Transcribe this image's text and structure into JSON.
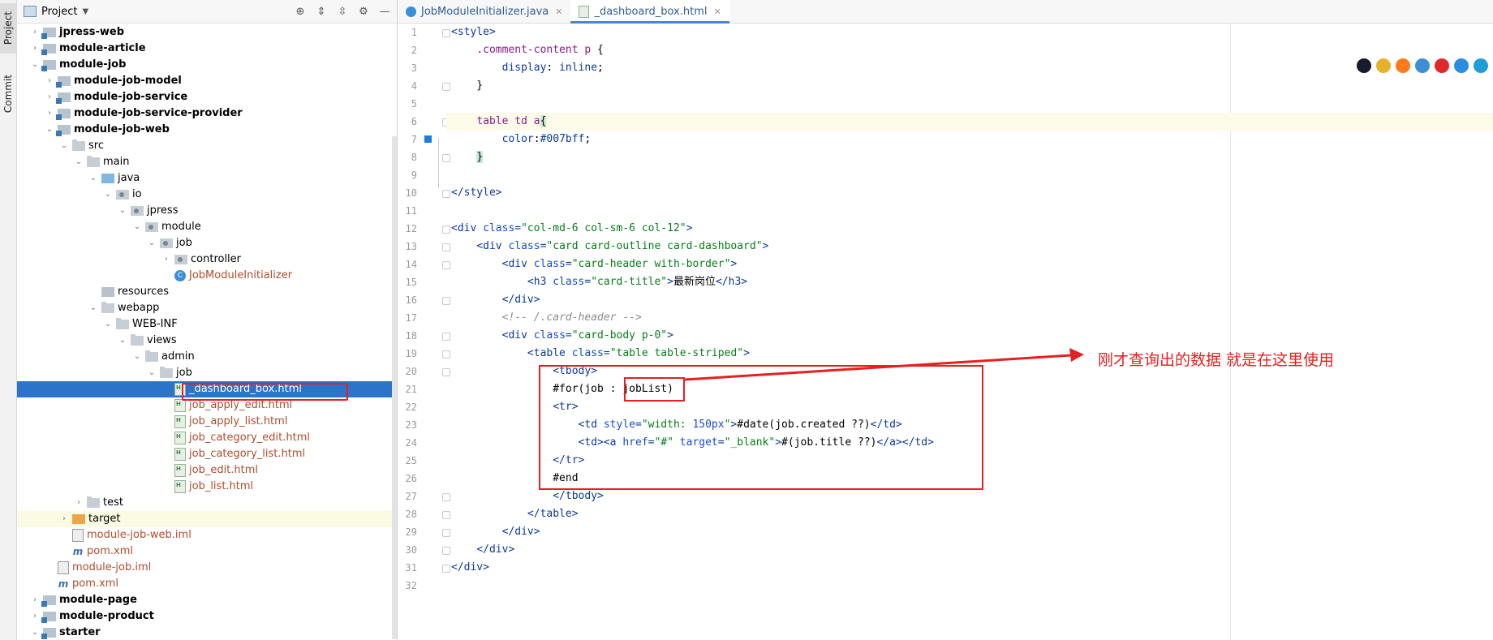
{
  "tool_strip": {
    "project_label": "Project",
    "commit_label": "Commit"
  },
  "project_panel": {
    "title": "Project",
    "tree": [
      {
        "label": "jpress-web",
        "indent": 1,
        "arrow": "closed",
        "icon": "modfolder",
        "style": "bold"
      },
      {
        "label": "module-article",
        "indent": 1,
        "arrow": "closed",
        "icon": "modfolder",
        "style": "bold"
      },
      {
        "label": "module-job",
        "indent": 1,
        "arrow": "open",
        "icon": "modfolder",
        "style": "bold"
      },
      {
        "label": "module-job-model",
        "indent": 2,
        "arrow": "closed",
        "icon": "modfolder",
        "style": "bold"
      },
      {
        "label": "module-job-service",
        "indent": 2,
        "arrow": "closed",
        "icon": "modfolder",
        "style": "bold"
      },
      {
        "label": "module-job-service-provider",
        "indent": 2,
        "arrow": "closed",
        "icon": "modfolder",
        "style": "bold"
      },
      {
        "label": "module-job-web",
        "indent": 2,
        "arrow": "open",
        "icon": "modfolder",
        "style": "bold"
      },
      {
        "label": "src",
        "indent": 3,
        "arrow": "open",
        "icon": "folder",
        "style": ""
      },
      {
        "label": "main",
        "indent": 4,
        "arrow": "open",
        "icon": "folder",
        "style": ""
      },
      {
        "label": "java",
        "indent": 5,
        "arrow": "open",
        "icon": "java",
        "style": ""
      },
      {
        "label": "io",
        "indent": 6,
        "arrow": "open",
        "icon": "pkg",
        "style": ""
      },
      {
        "label": "jpress",
        "indent": 7,
        "arrow": "open",
        "icon": "pkg",
        "style": ""
      },
      {
        "label": "module",
        "indent": 8,
        "arrow": "open",
        "icon": "pkg",
        "style": ""
      },
      {
        "label": "job",
        "indent": 9,
        "arrow": "open",
        "icon": "pkg",
        "style": ""
      },
      {
        "label": "controller",
        "indent": 10,
        "arrow": "closed",
        "icon": "pkg",
        "style": ""
      },
      {
        "label": "JobModuleInitializer",
        "indent": 10,
        "arrow": "",
        "icon": "cls",
        "style": "red"
      },
      {
        "label": "resources",
        "indent": 5,
        "arrow": "",
        "icon": "res",
        "style": ""
      },
      {
        "label": "webapp",
        "indent": 5,
        "arrow": "open",
        "icon": "folder",
        "style": ""
      },
      {
        "label": "WEB-INF",
        "indent": 6,
        "arrow": "open",
        "icon": "folder",
        "style": ""
      },
      {
        "label": "views",
        "indent": 7,
        "arrow": "open",
        "icon": "folder",
        "style": ""
      },
      {
        "label": "admin",
        "indent": 8,
        "arrow": "open",
        "icon": "folder",
        "style": ""
      },
      {
        "label": "job",
        "indent": 9,
        "arrow": "open",
        "icon": "folder",
        "style": ""
      },
      {
        "label": "_dashboard_box.html",
        "indent": 10,
        "arrow": "",
        "icon": "html",
        "style": "selected"
      },
      {
        "label": "job_apply_edit.html",
        "indent": 10,
        "arrow": "",
        "icon": "html",
        "style": "red"
      },
      {
        "label": "job_apply_list.html",
        "indent": 10,
        "arrow": "",
        "icon": "html",
        "style": "red"
      },
      {
        "label": "job_category_edit.html",
        "indent": 10,
        "arrow": "",
        "icon": "html",
        "style": "red"
      },
      {
        "label": "job_category_list.html",
        "indent": 10,
        "arrow": "",
        "icon": "html",
        "style": "red"
      },
      {
        "label": "job_edit.html",
        "indent": 10,
        "arrow": "",
        "icon": "html",
        "style": "red"
      },
      {
        "label": "job_list.html",
        "indent": 10,
        "arrow": "",
        "icon": "html",
        "style": "red"
      },
      {
        "label": "test",
        "indent": 4,
        "arrow": "closed",
        "icon": "folder",
        "style": ""
      },
      {
        "label": "target",
        "indent": 3,
        "arrow": "closed",
        "icon": "target",
        "style": "excluded"
      },
      {
        "label": "module-job-web.iml",
        "indent": 3,
        "arrow": "",
        "icon": "iml",
        "style": "red"
      },
      {
        "label": "pom.xml",
        "indent": 3,
        "arrow": "",
        "icon": "maven",
        "style": "red"
      },
      {
        "label": "module-job.iml",
        "indent": 2,
        "arrow": "",
        "icon": "iml",
        "style": "red"
      },
      {
        "label": "pom.xml",
        "indent": 2,
        "arrow": "",
        "icon": "maven",
        "style": "red"
      },
      {
        "label": "module-page",
        "indent": 1,
        "arrow": "closed",
        "icon": "modfolder",
        "style": "bold"
      },
      {
        "label": "module-product",
        "indent": 1,
        "arrow": "closed",
        "icon": "modfolder",
        "style": "bold"
      },
      {
        "label": "starter",
        "indent": 1,
        "arrow": "open",
        "icon": "modfolder",
        "style": "bold"
      }
    ]
  },
  "editor": {
    "tabs": [
      {
        "label": "JobModuleInitializer.java",
        "icon": "class",
        "active": false
      },
      {
        "label": "_dashboard_box.html",
        "icon": "html",
        "active": true
      }
    ],
    "lines": [
      [
        [
          "tg",
          "<style>"
        ]
      ],
      [
        [
          "tx",
          "    "
        ],
        [
          "sel",
          ".comment-content p"
        ],
        [
          "tx",
          " {"
        ]
      ],
      [
        [
          "tx",
          "        "
        ],
        [
          "pv",
          "display"
        ],
        [
          "tx",
          ": "
        ],
        [
          "vv",
          "inline"
        ],
        [
          "tx",
          ";"
        ]
      ],
      [
        [
          "tx",
          "    }"
        ]
      ],
      [
        [
          "tx",
          ""
        ]
      ],
      [
        [
          "tx",
          "    "
        ],
        [
          "sel",
          "table td a"
        ],
        [
          "br",
          "{"
        ]
      ],
      [
        [
          "tx",
          "        "
        ],
        [
          "pv",
          "color"
        ],
        [
          "tx",
          ":"
        ],
        [
          "vv",
          "#007bff"
        ],
        [
          "tx",
          ";"
        ]
      ],
      [
        [
          "tx",
          "    "
        ],
        [
          "br",
          "}"
        ]
      ],
      [
        [
          "tx",
          ""
        ]
      ],
      [
        [
          "tg",
          "</style>"
        ]
      ],
      [
        [
          "tx",
          ""
        ]
      ],
      [
        [
          "tg",
          "<div "
        ],
        [
          "at",
          "class"
        ],
        [
          "tg",
          "="
        ],
        [
          "av",
          "\"col-md-6 col-sm-6 col-12\""
        ],
        [
          "tg",
          ">"
        ]
      ],
      [
        [
          "tx",
          "    "
        ],
        [
          "tg",
          "<div "
        ],
        [
          "at",
          "class"
        ],
        [
          "tg",
          "="
        ],
        [
          "av",
          "\"card card-outline card-dashboard\""
        ],
        [
          "tg",
          ">"
        ]
      ],
      [
        [
          "tx",
          "        "
        ],
        [
          "tg",
          "<div "
        ],
        [
          "at",
          "class"
        ],
        [
          "tg",
          "="
        ],
        [
          "av",
          "\"card-header with-border\""
        ],
        [
          "tg",
          ">"
        ]
      ],
      [
        [
          "tx",
          "            "
        ],
        [
          "tg",
          "<h3 "
        ],
        [
          "at",
          "class"
        ],
        [
          "tg",
          "="
        ],
        [
          "av",
          "\"card-title\""
        ],
        [
          "tg",
          ">"
        ],
        [
          "tx",
          "最新岗位"
        ],
        [
          "tg",
          "</h3>"
        ]
      ],
      [
        [
          "tx",
          "        "
        ],
        [
          "tg",
          "</div>"
        ]
      ],
      [
        [
          "tx",
          "        "
        ],
        [
          "cm",
          "<!-- /.card-header -->"
        ]
      ],
      [
        [
          "tx",
          "        "
        ],
        [
          "tg",
          "<div "
        ],
        [
          "at",
          "class"
        ],
        [
          "tg",
          "="
        ],
        [
          "av",
          "\"card-body p-0\""
        ],
        [
          "tg",
          ">"
        ]
      ],
      [
        [
          "tx",
          "            "
        ],
        [
          "tg",
          "<table "
        ],
        [
          "at",
          "class"
        ],
        [
          "tg",
          "="
        ],
        [
          "av",
          "\"table table-striped\""
        ],
        [
          "tg",
          ">"
        ]
      ],
      [
        [
          "tx",
          "                "
        ],
        [
          "tg",
          "<tbody>"
        ]
      ],
      [
        [
          "tx",
          "                #for(job : jobList)"
        ]
      ],
      [
        [
          "tx",
          "                "
        ],
        [
          "tg",
          "<tr>"
        ]
      ],
      [
        [
          "tx",
          "                    "
        ],
        [
          "tg",
          "<td "
        ],
        [
          "at",
          "style"
        ],
        [
          "tg",
          "="
        ],
        [
          "av",
          "\"width: "
        ],
        [
          "at",
          "150px"
        ],
        [
          "av",
          "\""
        ],
        [
          "tg",
          ">"
        ],
        [
          "tx",
          "#date(job.created ??)"
        ],
        [
          "tg",
          "</td>"
        ]
      ],
      [
        [
          "tx",
          "                    "
        ],
        [
          "tg",
          "<td><a "
        ],
        [
          "at",
          "href"
        ],
        [
          "tg",
          "="
        ],
        [
          "av",
          "\"#\" "
        ],
        [
          "at",
          "target"
        ],
        [
          "tg",
          "="
        ],
        [
          "av",
          "\"_blank\""
        ],
        [
          "tg",
          ">"
        ],
        [
          "tx",
          "#(job.title ??)"
        ],
        [
          "tg",
          "</a></td>"
        ]
      ],
      [
        [
          "tx",
          "                "
        ],
        [
          "tg",
          "</tr>"
        ]
      ],
      [
        [
          "tx",
          "                #end"
        ]
      ],
      [
        [
          "tx",
          "                "
        ],
        [
          "tg",
          "</tbody>"
        ]
      ],
      [
        [
          "tx",
          "            "
        ],
        [
          "tg",
          "</table>"
        ]
      ],
      [
        [
          "tx",
          "        "
        ],
        [
          "tg",
          "</div>"
        ]
      ],
      [
        [
          "tx",
          "    "
        ],
        [
          "tg",
          "</div>"
        ]
      ],
      [
        [
          "tg",
          "</div>"
        ]
      ],
      [
        [
          "tx",
          ""
        ]
      ]
    ]
  },
  "annotation": {
    "text": "刚才查询出的数据 就是在这里使用"
  },
  "browser_icons": [
    {
      "name": "intellij-icon",
      "color": "#1a1a2e"
    },
    {
      "name": "chrome-icon",
      "color": "#e8b12a"
    },
    {
      "name": "firefox-icon",
      "color": "#ff7a1a"
    },
    {
      "name": "safari-icon",
      "color": "#3a8fd6"
    },
    {
      "name": "opera-icon",
      "color": "#e0282f"
    },
    {
      "name": "ie-icon",
      "color": "#2a8ee0"
    },
    {
      "name": "edge-icon",
      "color": "#1e9ed6"
    }
  ]
}
